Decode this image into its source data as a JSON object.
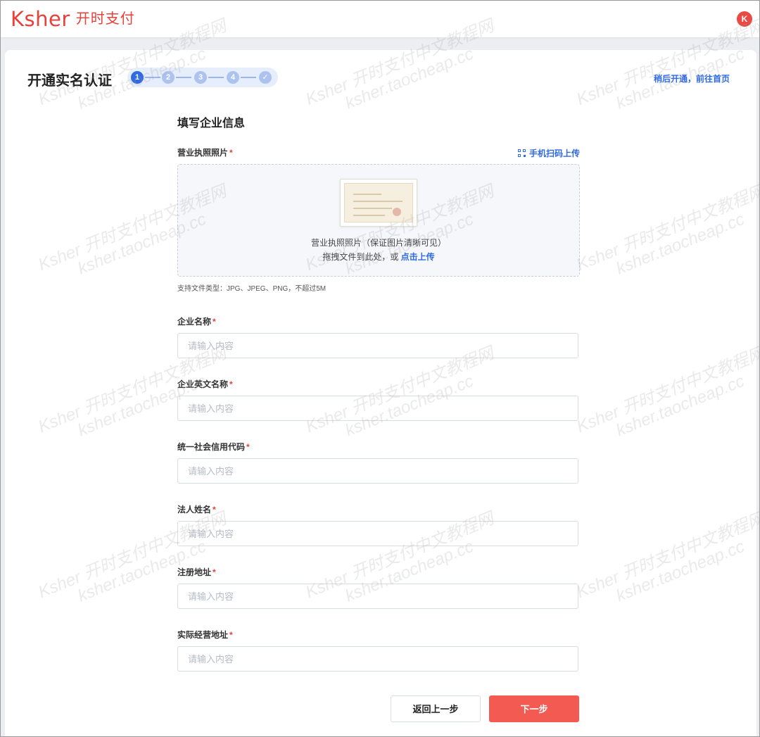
{
  "header": {
    "logo_word": "Ksher",
    "logo_cn": "开时支付",
    "avatar_letter": "K"
  },
  "page": {
    "title": "开通实名认证",
    "later_link": "稍后开通，前往首页"
  },
  "stepper": {
    "steps": [
      "1",
      "2",
      "3",
      "4",
      "✓"
    ],
    "active_index": 0
  },
  "form": {
    "section_title": "填写企业信息",
    "license_label": "营业执照照片",
    "required_mark": "*",
    "scan_link": "手机扫码上传",
    "upload_caption": "营业执照照片（保证图片清晰可见）",
    "upload_drag_text": "拖拽文件到此处，或 ",
    "upload_click_text": "点击上传",
    "file_hint": "支持文件类型：JPG、JPEG、PNG，不超过5M",
    "fields": [
      {
        "label": "企业名称",
        "placeholder": "请输入内容",
        "value": ""
      },
      {
        "label": "企业英文名称",
        "placeholder": "请输入内容",
        "value": ""
      },
      {
        "label": "统一社会信用代码",
        "placeholder": "请输入内容",
        "value": ""
      },
      {
        "label": "法人姓名",
        "placeholder": "请输入内容",
        "value": ""
      },
      {
        "label": "注册地址",
        "placeholder": "请输入内容",
        "value": ""
      },
      {
        "label": "实际经营地址",
        "placeholder": "请输入内容",
        "value": ""
      }
    ],
    "back_button": "返回上一步",
    "next_button": "下一步"
  },
  "watermark": {
    "line1": "Ksher 开时支付中文教程网",
    "line2": "ksher.taocheap.cc"
  },
  "colors": {
    "brand": "#e8413a",
    "link": "#2f6ae3",
    "next_button": "#f25a52"
  }
}
